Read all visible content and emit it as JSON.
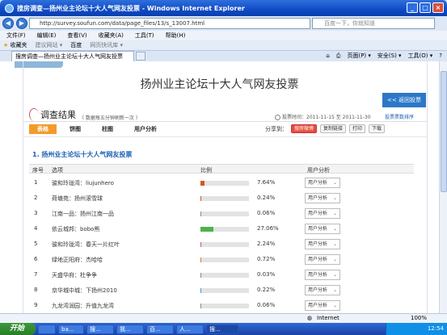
{
  "window": {
    "title": "搜房调查—扬州业主论坛十大人气网友投票 - Windows Internet Explorer"
  },
  "address": {
    "url": "http://survey.soufun.com/data/page_files/13/s_13007.html",
    "search_placeholder": "百度一下，你就知道"
  },
  "menu": [
    "文件(F)",
    "编辑(E)",
    "查看(V)",
    "收藏夹(A)",
    "工具(T)",
    "帮助(H)"
  ],
  "favorites": {
    "label": "收藏夹",
    "items": [
      "建议网站 ▾",
      "百度",
      "网页快讯库 ▾"
    ]
  },
  "tab": {
    "label": "搜房调查—扬州业主论坛十大人气网友投票"
  },
  "toolbar": {
    "page": "页面(P) ▾",
    "safety": "安全(S) ▾",
    "tools": "工具(O) ▾",
    "help": "?"
  },
  "page": {
    "title": "扬州业主论坛十大人气网友投票",
    "back_button": "<< 返回投票",
    "result_title": "调查结果",
    "result_note": "（ 数据每五分钟刷新一次 ）",
    "vote_time": "投票时间：2011-11-15 至 2011-11-30",
    "sort_link": "投票票数排序",
    "view_tabs": [
      "表格",
      "饼图",
      "柱图",
      "用户分析"
    ],
    "share_label": "分享到：",
    "share_buttons": [
      "搜房微博",
      "复制链接",
      "打印",
      "下载"
    ],
    "question": "1.    扬州业主论坛十大人气网友投票",
    "columns": [
      "序号",
      "选项",
      "比例",
      "用户分析"
    ],
    "rows": [
      {
        "no": "1",
        "option": "骏和玲珑湾：liujunhero",
        "pct": "7.64%",
        "value": 0.0764,
        "color": "#d9531e",
        "action": "用户分析"
      },
      {
        "no": "2",
        "option": "荷塘苑：扬州滚雪球",
        "pct": "0.24%",
        "value": 0.0024,
        "color": "#d9531e",
        "action": "用户分析"
      },
      {
        "no": "3",
        "option": "江南一品：扬州江南一品",
        "pct": "0.06%",
        "value": 0.0006,
        "color": "#888888",
        "action": "用户分析"
      },
      {
        "no": "4",
        "option": "依云城邦：bobo熊",
        "pct": "27.06%",
        "value": 0.2706,
        "color": "#4bb34b",
        "action": "用户分析"
      },
      {
        "no": "5",
        "option": "骏和玲珑湾：春天一片红叶",
        "pct": "2.24%",
        "value": 0.0224,
        "color": "#e0534b",
        "action": "用户分析"
      },
      {
        "no": "6",
        "option": "绿地正阳府：杰哈哈",
        "pct": "0.72%",
        "value": 0.0072,
        "color": "#e07a2e",
        "action": "用户分析"
      },
      {
        "no": "7",
        "option": "天盛华府：杜争争",
        "pct": "0.03%",
        "value": 0.0003,
        "color": "#888888",
        "action": "用户分析"
      },
      {
        "no": "8",
        "option": "京华城中城：下扬州2010",
        "pct": "0.22%",
        "value": 0.0022,
        "color": "#3aa0c8",
        "action": "用户分析"
      },
      {
        "no": "9",
        "option": "九龙湾润园：升值九龙湾",
        "pct": "0.06%",
        "value": 0.0006,
        "color": "#888888",
        "action": "用户分析"
      }
    ]
  },
  "status": {
    "zone": "Internet",
    "zoom": "100%"
  },
  "taskbar": {
    "start": "开始",
    "tasks": [
      "",
      "ba...",
      "搜...",
      "我...",
      "百...",
      "人...",
      "搜..."
    ],
    "clock": "12:54"
  }
}
